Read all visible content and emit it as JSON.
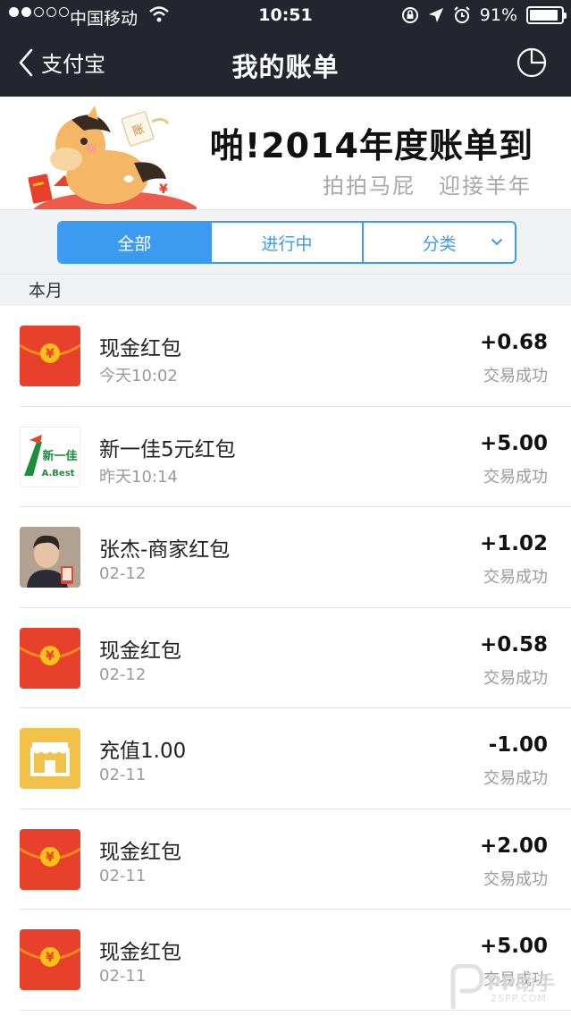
{
  "status_bar": {
    "carrier": "中国移动",
    "time": "10:51",
    "battery": "91%",
    "battery_level": 0.91
  },
  "nav": {
    "back_label": "支付宝",
    "title": "我的账单"
  },
  "banner": {
    "headline": "啪!2014年度账单到",
    "subline": "拍拍马屁　迎接羊年",
    "envelope_text": "账"
  },
  "tabs": {
    "all": "全部",
    "in_progress": "进行中",
    "category": "分类"
  },
  "section_header": "本月",
  "transactions": [
    {
      "icon": "red-envelope-icon",
      "name": "现金红包",
      "date": "今天10:02",
      "amount": "+0.68",
      "status": "交易成功"
    },
    {
      "icon": "xinyijia-logo",
      "name": "新一佳5元红包",
      "date": "昨天10:14",
      "amount": "+5.00",
      "status": "交易成功",
      "logo_text": "新一佳",
      "logo_sub": "A.Best"
    },
    {
      "icon": "merchant-avatar",
      "name": "张杰-商家红包",
      "date": "02-12",
      "amount": "+1.02",
      "status": "交易成功"
    },
    {
      "icon": "red-envelope-icon",
      "name": "现金红包",
      "date": "02-12",
      "amount": "+0.58",
      "status": "交易成功"
    },
    {
      "icon": "shop-icon",
      "name": "充值1.00",
      "date": "02-11",
      "amount": "-1.00",
      "status": "交易成功"
    },
    {
      "icon": "red-envelope-icon",
      "name": "现金红包",
      "date": "02-11",
      "amount": "+2.00",
      "status": "交易成功"
    },
    {
      "icon": "red-envelope-icon",
      "name": "现金红包",
      "date": "02-11",
      "amount": "+5.00",
      "status": "交易成功"
    }
  ],
  "watermark": {
    "text": "PP助手",
    "sub": "25PP.COM"
  },
  "colors": {
    "nav_bg": "#23262f",
    "accent_blue": "#3c9af0",
    "envelope_red": "#e8412b",
    "envelope_gold": "#f5c01b",
    "shop_yellow": "#f2c14a"
  }
}
